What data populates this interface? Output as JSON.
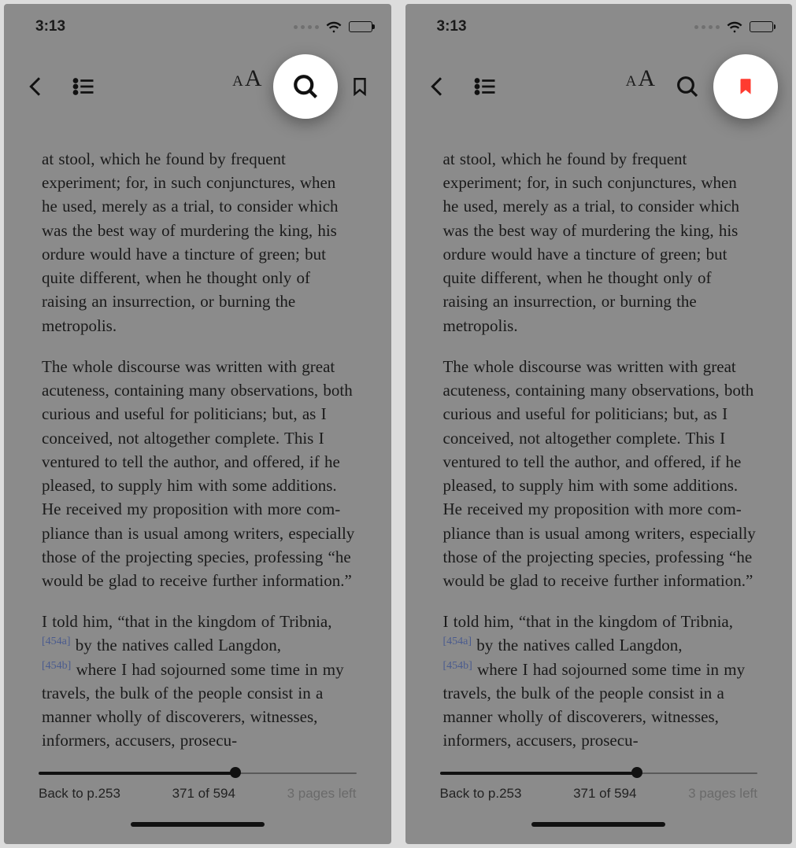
{
  "status": {
    "time": "3:13"
  },
  "toolbar": {
    "icons": {
      "back": "chevron-left-icon",
      "toc": "list-icon",
      "font": "font-size-icon",
      "search": "search-icon",
      "bookmark": "bookmark-icon",
      "bookmark_filled": "bookmark-filled-icon"
    },
    "font_small": "A",
    "font_large": "A"
  },
  "content": {
    "para1": "at stool, which he found by frequent experiment; for, in such conjunctures, when he used, merely as a trial, to con­sider which was the best way of murder­ing the king, his ordure would have a tincture of green; but quite different, when he thought only of raising an insur­rection, or burning the metropolis.",
    "para2": "The whole discourse was written with great acuteness, containing many obser­vations, both curious and useful for politicians; but, as I conceived, not alto­gether complete.  This I ventured to tell the author, and offered, if he pleased, to supply him with some additions.  He received my proposition with more com­pliance than is usual among writers, espe­cially those of the projecting species, professing “he would be glad to receive further information.”",
    "para3_a": "I told him, “that in the kingdom of Trib­nia,",
    "para3_note1": "[454a]",
    "para3_b": " by the natives called Langdon,",
    "para3_note2": "[454b]",
    "para3_c": " where I had sojourned some time in my travels, the bulk of the people con­sist in a manner wholly of discoverers, witnesses, informers, accusers, prosecu-"
  },
  "footer": {
    "back_label": "Back to p.253",
    "position": "371 of 594",
    "remaining": "3 pages left",
    "progress_percent": 62
  },
  "colors": {
    "bookmark_active": "#ff3b30"
  }
}
